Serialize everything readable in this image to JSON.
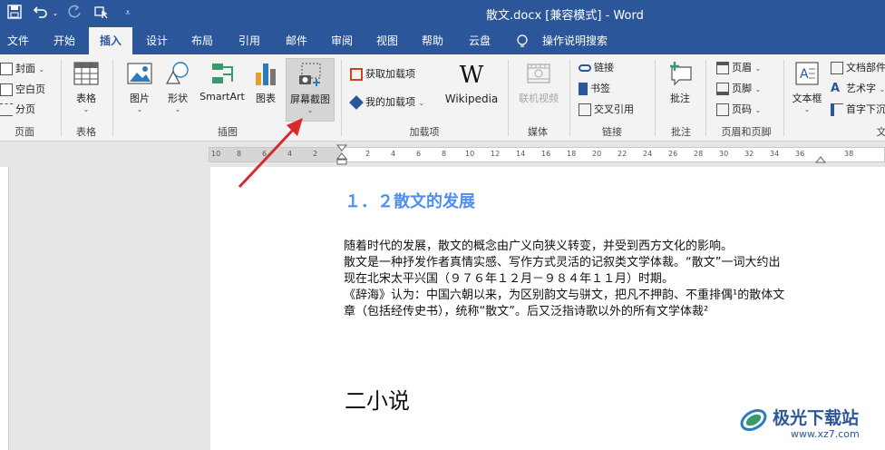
{
  "window": {
    "title": "散文.docx [兼容模式]  -  Word"
  },
  "tabs": [
    {
      "label": "文件"
    },
    {
      "label": "开始"
    },
    {
      "label": "插入"
    },
    {
      "label": "设计"
    },
    {
      "label": "布局"
    },
    {
      "label": "引用"
    },
    {
      "label": "邮件"
    },
    {
      "label": "审阅"
    },
    {
      "label": "视图"
    },
    {
      "label": "帮助"
    },
    {
      "label": "云盘"
    },
    {
      "label": "操作说明搜索"
    }
  ],
  "ribbon": {
    "pages": {
      "cover": "封面",
      "blank": "空白页",
      "break": "分页",
      "label": "页面"
    },
    "tables": {
      "table": "表格",
      "label": "表格"
    },
    "illustrations": {
      "picture": "图片",
      "shapes": "形状",
      "smartart": "SmartArt",
      "chart": "图表",
      "screenshot": "屏幕截图",
      "label": "插图"
    },
    "addins": {
      "get": "获取加载项",
      "my": "我的加载项",
      "wikipedia": "Wikipedia",
      "label": "加载项"
    },
    "media": {
      "video": "联机视频",
      "label": "媒体"
    },
    "links": {
      "link": "链接",
      "bookmark": "书签",
      "cross": "交叉引用",
      "label": "链接"
    },
    "comments": {
      "comment": "批注",
      "label": "批注"
    },
    "header_footer": {
      "header": "页眉",
      "footer": "页脚",
      "page_number": "页码",
      "label": "页眉和页脚"
    },
    "text": {
      "textbox": "文本框",
      "docparts": "文档部件",
      "wordart": "艺术字",
      "dropcap": "首字下沉",
      "label": "文"
    }
  },
  "ruler": {
    "numbers": [
      "10",
      "8",
      "6",
      "4",
      "2",
      "2",
      "4",
      "6",
      "8",
      "10",
      "12",
      "14",
      "16",
      "18",
      "20",
      "22",
      "24",
      "26",
      "28",
      "30",
      "32",
      "34",
      "36",
      "38"
    ]
  },
  "document": {
    "heading1": "１．２散文的发展",
    "paragraphs": [
      "随着时代的发展，散文的概念由广义向狭义转变，并受到西方文化的影响。",
      "散文是一种抒发作者真情实感、写作方式灵活的记叙类文学体裁。“散文”一词大约出",
      "现在北宋太平兴国（９７６年１２月－９８４年１１月）时期。",
      "《辞海》认为：中国六朝以来，为区别韵文与骈文，把凡不押韵、不重排偶¹的散体文",
      "章（包括经传史书），统称“散文”。后又泛指诗歌以外的所有文学体裁²"
    ],
    "heading2": "二小说"
  },
  "watermark": {
    "brand": "极光下载站",
    "url": "www.xz7.com"
  }
}
